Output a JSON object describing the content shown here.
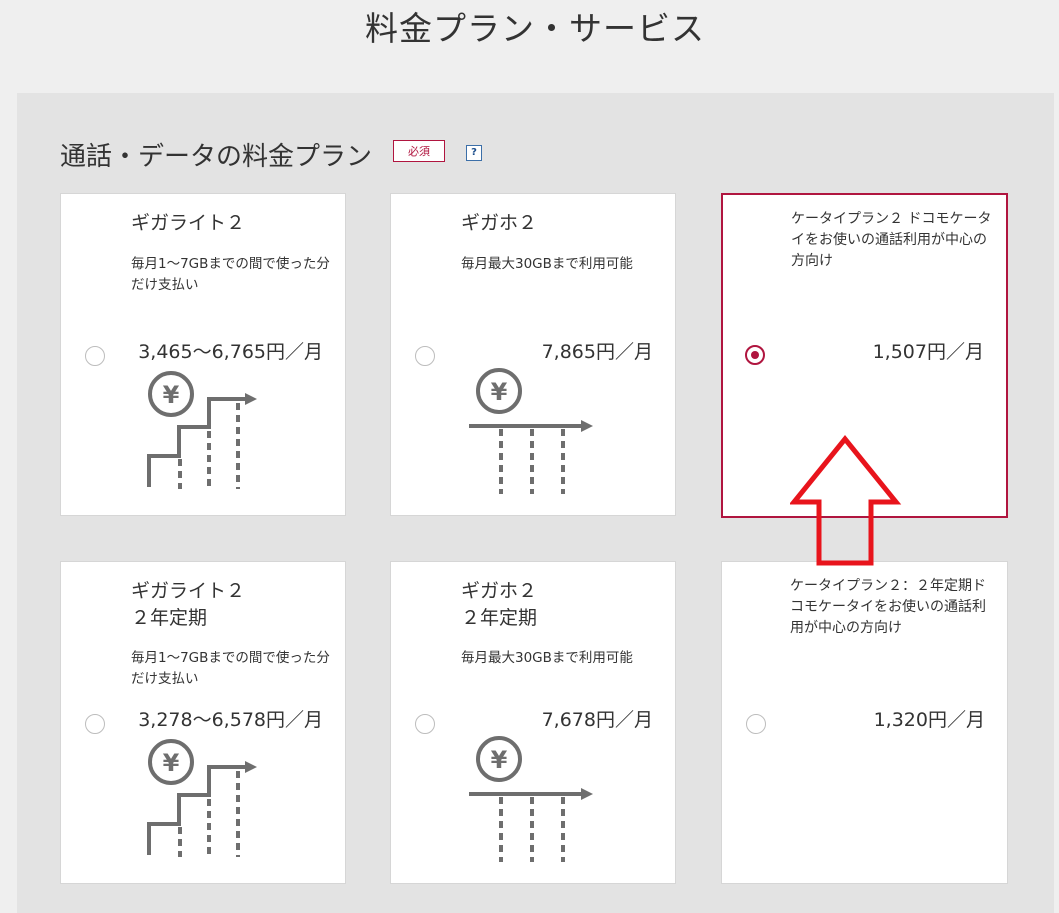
{
  "page_title": "料金プラン・サービス",
  "section": {
    "title": "通話・データの料金プラン",
    "required_badge": "必須",
    "help_icon": "?"
  },
  "plans": [
    {
      "name": "ギガライト２",
      "desc": "毎月1～7GBまでの間で使った分だけ支払い",
      "price": "3,465～6,765円／月",
      "selected": false,
      "icon": "yen-staircase-icon"
    },
    {
      "name": "ギガホ２",
      "desc": "毎月最大30GBまで利用可能",
      "price": "7,865円／月",
      "selected": false,
      "icon": "yen-flat-icon"
    },
    {
      "name": "",
      "desc": "ケータイプラン２ ドコモケータイをお使いの通話利用が中心の方向け",
      "price": "1,507円／月",
      "selected": true,
      "icon": ""
    },
    {
      "name": "ギガライト２\n２年定期",
      "desc": "毎月1～7GBまでの間で使った分だけ支払い",
      "price": "3,278～6,578円／月",
      "selected": false,
      "icon": "yen-staircase-icon"
    },
    {
      "name": "ギガホ２\n２年定期",
      "desc": "毎月最大30GBまで利用可能",
      "price": "7,678円／月",
      "selected": false,
      "icon": "yen-flat-icon"
    },
    {
      "name": "",
      "desc": "ケータイプラン２：２年定期ドコモケータイをお使いの通話利用が中心の方向け",
      "price": "1,320円／月",
      "selected": false,
      "icon": ""
    }
  ],
  "colors": {
    "accent": "#b0153f",
    "annotation_arrow": "#e8141c",
    "icon_gray": "#6e6e6e"
  }
}
